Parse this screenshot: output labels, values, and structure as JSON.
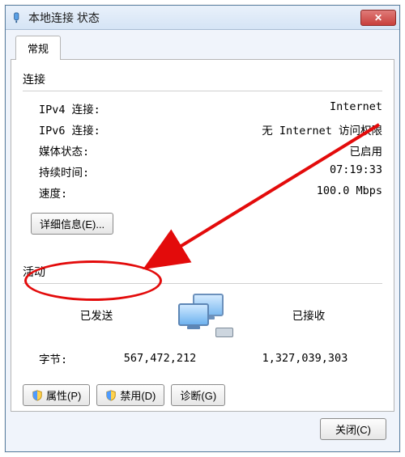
{
  "window": {
    "title": "本地连接 状态",
    "close_label": "✕"
  },
  "tab": {
    "general": "常规"
  },
  "connection": {
    "heading": "连接",
    "rows": {
      "ipv4_label": "IPv4 连接:",
      "ipv4_value": "Internet",
      "ipv6_label": "IPv6 连接:",
      "ipv6_value": "无 Internet 访问权限",
      "media_label": "媒体状态:",
      "media_value": "已启用",
      "duration_label": "持续时间:",
      "duration_value": "07:19:33",
      "speed_label": "速度:",
      "speed_value": "100.0 Mbps"
    },
    "details_button": "详细信息(E)..."
  },
  "activity": {
    "heading": "活动",
    "sent_label": "已发送",
    "recv_label": "已接收",
    "bytes_label": "字节:",
    "sent_bytes": "567,472,212",
    "recv_bytes": "1,327,039,303"
  },
  "actions": {
    "properties": "属性(P)",
    "disable": "禁用(D)",
    "diagnose": "诊断(G)"
  },
  "footer": {
    "close": "关闭(C)"
  }
}
